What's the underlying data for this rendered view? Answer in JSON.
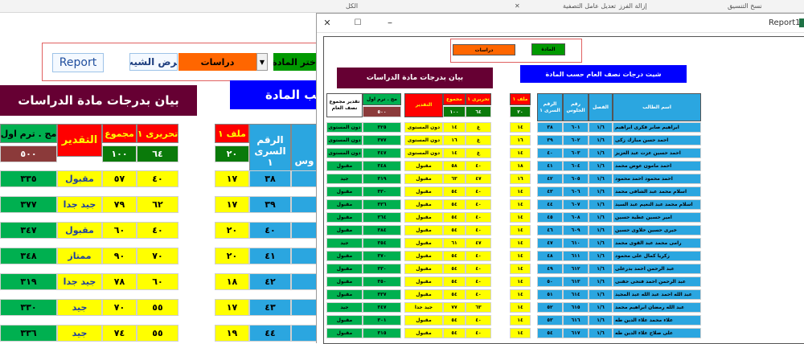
{
  "ribbon": {
    "items": [
      "إزالة الفرز",
      "تعديل عامل التصفية",
      "الكل",
      "نسخ التنسيق"
    ],
    "close_glyph": "✕"
  },
  "left": {
    "select_subject_label": "اختر المادة",
    "subject_value": "دراسات",
    "show_sheet_label": "عرض الشيت",
    "report_button_label": "Report",
    "banner_title": "بيان بدرجات مادة الدراسات",
    "banner_subject_partial": "سب المادة",
    "headers": {
      "cumulative": "مج . ترم اول",
      "grade": "التقدير",
      "total": "مجموع",
      "written1": "تحريرى ١",
      "file1": "ملف ١",
      "seat_number": "الرقم السرى ١",
      "seat_partial": "وس"
    },
    "max_row": {
      "cumulative": "٥٠٠",
      "total": "١٠٠",
      "written1": "٦٤",
      "file1": "٢٠"
    },
    "rows": [
      {
        "cumulative": "٣٣٥",
        "grade": "مقبول",
        "total": "٥٧",
        "written1": "٤٠",
        "file1": "١٧",
        "seat": "٣٨"
      },
      {
        "cumulative": "٣٧٧",
        "grade": "جيد جدا",
        "total": "٧٩",
        "written1": "٦٢",
        "file1": "١٧",
        "seat": "٣٩"
      },
      {
        "cumulative": "٣٤٧",
        "grade": "مقبول",
        "total": "٦٠",
        "written1": "٤٠",
        "file1": "٢٠",
        "seat": "٤٠"
      },
      {
        "cumulative": "٣٤٨",
        "grade": "ممتاز",
        "total": "٩٠",
        "written1": "٧٠",
        "file1": "٢٠",
        "seat": "٤١"
      },
      {
        "cumulative": "٣١٩",
        "grade": "جيد جدا",
        "total": "٧٨",
        "written1": "٦٠",
        "file1": "١٨",
        "seat": "٤٢"
      },
      {
        "cumulative": "٣٣٠",
        "grade": "جيد",
        "total": "٧٠",
        "written1": "٥٥",
        "file1": "١٧",
        "seat": "٤٣"
      },
      {
        "cumulative": "٣٣٦",
        "grade": "جيد",
        "total": "٧٤",
        "written1": "٥٥",
        "file1": "١٩",
        "seat": "٤٤"
      }
    ]
  },
  "report": {
    "window_title": "Report1",
    "subject_label": "المادة",
    "subject_value": "دراسات",
    "banner_left": "بيان بدرجات مادة الدراسات",
    "banner_right": "شيت درجات نصف العام حسب المادة",
    "headers": {
      "cum_grade": "تقدير مجموع نصف العام",
      "cumulative": "مج . ترم اول",
      "grade": "التقدير",
      "total": "مجموع",
      "written1": "تحريرى ١",
      "file1": "ملف ١",
      "seat": "الرقم السرى ١",
      "sitting": "رقم الجلوس",
      "class": "الفصل",
      "name": "اسم الطالب"
    },
    "max_row": {
      "cumulative": "٥٠٠",
      "total": "١٠٠",
      "written1": "٦٤",
      "file1": "٢٠"
    },
    "rows": [
      {
        "cg": "دون المستوى",
        "cum": "٣٢٥",
        "grade": "دون المستوى",
        "total": "١٤",
        "w": "غ",
        "f": "١٤",
        "seat": "٣٨",
        "sit": "٦٠١",
        "cls": "١/٦",
        "name": "ابراهيم صابر فكرى ابراهيم"
      },
      {
        "cg": "دون المستوى",
        "cum": "٣٧٧",
        "grade": "دون المستوى",
        "total": "١٦",
        "w": "غ",
        "f": "١٦",
        "seat": "٣٩",
        "sit": "٦٠٢",
        "cls": "١/٦",
        "name": "احمد حسن مبارك زكى"
      },
      {
        "cg": "دون المستوى",
        "cum": "٣٤٧",
        "grade": "دون المستوى",
        "total": "١٤",
        "w": "غ",
        "f": "١٤",
        "seat": "٤٠",
        "sit": "٦٠٣",
        "cls": "١/٦",
        "name": "احمد حسين عزت عبد العزيز"
      },
      {
        "cg": "مقبول",
        "cum": "٣٤٨",
        "grade": "مقبول",
        "total": "٥٨",
        "w": "٤٠",
        "f": "١٨",
        "seat": "٤١",
        "sit": "٦٠٤",
        "cls": "١/٦",
        "name": "احمد مامون عوض محمد"
      },
      {
        "cg": "جيد",
        "cum": "٣١٩",
        "grade": "مقبول",
        "total": "٦٣",
        "w": "٤٧",
        "f": "١٦",
        "seat": "٤٢",
        "sit": "٦٠٥",
        "cls": "١/٦",
        "name": "احمد محمود احمد محمود"
      },
      {
        "cg": "مقبول",
        "cum": "٣٣٠",
        "grade": "مقبول",
        "total": "٥٤",
        "w": "٤٠",
        "f": "١٤",
        "seat": "٤٣",
        "sit": "٦٠٦",
        "cls": "١/٦",
        "name": "اسلام محمد عبد الشافى محمد"
      },
      {
        "cg": "مقبول",
        "cum": "٣٣٦",
        "grade": "مقبول",
        "total": "٥٤",
        "w": "٤٠",
        "f": "١٤",
        "seat": "٤٤",
        "sit": "٦٠٧",
        "cls": "١/٦",
        "name": "اسلام محمد عبد النعيم عبد السيد"
      },
      {
        "cg": "مقبول",
        "cum": "٣٦٤",
        "grade": "مقبول",
        "total": "٥٤",
        "w": "٤٠",
        "f": "١٤",
        "seat": "٤٥",
        "sit": "٦٠٨",
        "cls": "١/٦",
        "name": "امير حسين عطية حسين"
      },
      {
        "cg": "مقبول",
        "cum": "٣٨٤",
        "grade": "مقبول",
        "total": "٥٤",
        "w": "٤٠",
        "f": "١٤",
        "seat": "٤٦",
        "sit": "٦٠٩",
        "cls": "١/٦",
        "name": "خيرى حسين خلاوى حسين"
      },
      {
        "cg": "جيد",
        "cum": "٣٥٤",
        "grade": "مقبول",
        "total": "٦١",
        "w": "٤٧",
        "f": "١٤",
        "seat": "٤٧",
        "sit": "٦١٠",
        "cls": "١/٦",
        "name": "رامى محمد عبد القوى محمد"
      },
      {
        "cg": "مقبول",
        "cum": "٣٧٠",
        "grade": "مقبول",
        "total": "٥٤",
        "w": "٤٠",
        "f": "١٤",
        "seat": "٤٨",
        "sit": "٦١١",
        "cls": "١/٦",
        "name": "زكريا كمال على محمود"
      },
      {
        "cg": "مقبول",
        "cum": "٣٣٠",
        "grade": "مقبول",
        "total": "٥٤",
        "w": "٤٠",
        "f": "١٤",
        "seat": "٤٩",
        "sit": "٦١٢",
        "cls": "١/٦",
        "name": "عبد الرحمن احمد بدرعلى"
      },
      {
        "cg": "مقبول",
        "cum": "٣٥٠",
        "grade": "مقبول",
        "total": "٥٤",
        "w": "٤٠",
        "f": "١٤",
        "seat": "٥٠",
        "sit": "٦١٣",
        "cls": "١/٦",
        "name": "عبد الرحمن احمد فتحى حفنى"
      },
      {
        "cg": "مقبول",
        "cum": "٣٣٧",
        "grade": "مقبول",
        "total": "٥٤",
        "w": "٤٠",
        "f": "١٤",
        "seat": "٥١",
        "sit": "٦١٤",
        "cls": "١/٦",
        "name": "عبد الله احمد عبد الله عبد المجيد"
      },
      {
        "cg": "جيد",
        "cum": "٣٤٧",
        "grade": "جيد جدا",
        "total": "٧٧",
        "w": "٦٣",
        "f": "١٤",
        "seat": "٥٢",
        "sit": "٦١٥",
        "cls": "١/٦",
        "name": "عبد الله رمضان ابراهيم محمد"
      },
      {
        "cg": "مقبول",
        "cum": "٣٠١",
        "grade": "مقبول",
        "total": "٥٤",
        "w": "٤٠",
        "f": "١٤",
        "seat": "٥٣",
        "sit": "٦١٦",
        "cls": "١/٦",
        "name": "علاء محمد علاء الدين طه"
      },
      {
        "cg": "مقبول",
        "cum": "٣١٥",
        "grade": "مقبول",
        "total": "٥٤",
        "w": "٤٠",
        "f": "١٤",
        "seat": "٥٤",
        "sit": "٦١٧",
        "cls": "١/٦",
        "name": "على صلاح علاء الدين طه"
      }
    ]
  },
  "colors": {
    "green": "#00b050",
    "dark_green": "#0a7a0a",
    "red": "#ff0000",
    "yellow": "#ffff00",
    "cyan": "#2ba6e0",
    "blue": "#0000ff",
    "maroon": "#660033",
    "orange": "#ff6600",
    "brown": "#8b3a3a"
  }
}
